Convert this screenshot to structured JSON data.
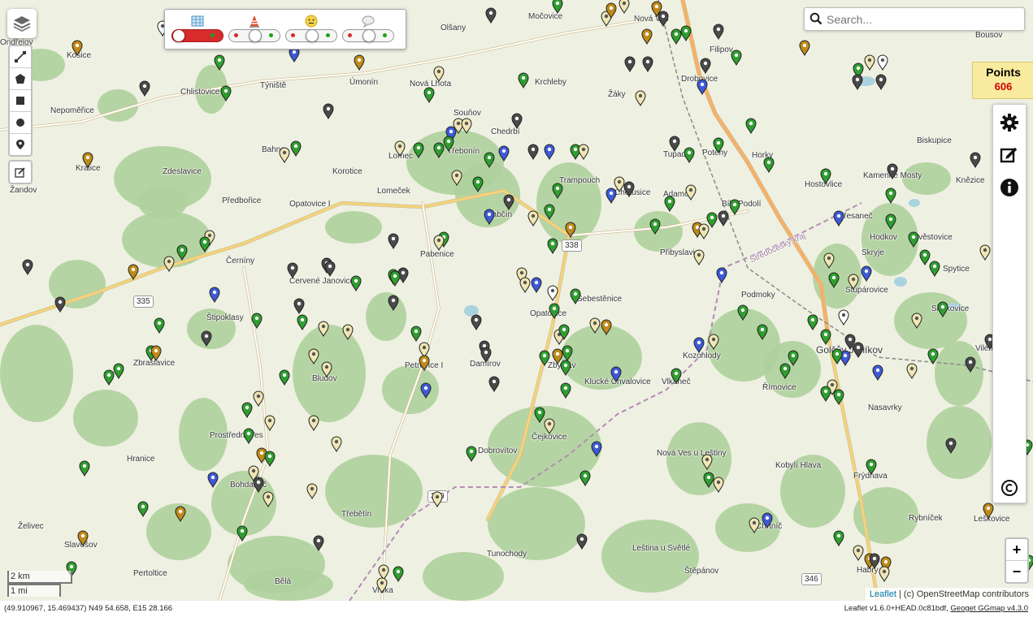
{
  "search": {
    "placeholder": "Search..."
  },
  "points": {
    "label": "Points",
    "count": "606"
  },
  "zoom": {
    "in_label": "+",
    "out_label": "−"
  },
  "scale": {
    "metric": "2 km",
    "imperial": "1 mi"
  },
  "attribution": {
    "leaflet": "Leaflet",
    "text": " | (c) OpenStreetMap contributors"
  },
  "footer": {
    "coords": "(49.910967, 15.469437) N49 54.658, E15 28.166",
    "version_prefix": "Leaflet v1.6.0+HEAD.0c81bdf, ",
    "version_link": "Geoget GGmap v4.3.0"
  },
  "colors": {
    "slider_active": "#d62c2c",
    "points_count": "#d00000",
    "points_bg": "#f8eb9e",
    "forest": "#aed09c"
  },
  "places": [
    "Ondřejov",
    "Kosice",
    "Chlistovice",
    "Týniště",
    "Úmonín",
    "Nová Lhota",
    "Olšany",
    "Močovice",
    "Nová Ves",
    "Filipov",
    "Krchleby",
    "Žáky",
    "Drobovice",
    "Bousov",
    "Nepoměřice",
    "Souňov",
    "Chedrbí",
    "Bahno",
    "Lomec",
    "Třebonín",
    "Tupadly",
    "Potěhy",
    "Horky",
    "Biskupice",
    "Kralice",
    "Zdeslavice",
    "Korotice",
    "Žandov",
    "Předbořice",
    "Lomeček",
    "Trampouch",
    "Chotusice",
    "Adamov",
    "Bílé Podolí",
    "Hostovlice",
    "Kamenné Mosty",
    "Opatovice I",
    "Vrabčín",
    "Pabenice",
    "Přibyslavice",
    "Třesaneč",
    "Zvěstovice",
    "Knězice",
    "Černíny",
    "Červené Janovice",
    "Podmoky",
    "Hodkov",
    "Skryje",
    "Spytice",
    "Štipoklasy",
    "Šebestěnice",
    "Opatovice",
    "Stupárovice",
    "Siřákovice",
    "Zbraslavice",
    "Bludov",
    "Petrovice I",
    "Damírov",
    "Zbyslav",
    "Klucké Chvalovice",
    "Vlkaneč",
    "Kozohlody",
    "Golčův Jeníkov",
    "Vilémov",
    "Římovice",
    "Nasavrky",
    "Prostřední Ves",
    "Hranice",
    "Čejkovice",
    "Dobrovítov",
    "Nová Ves u Leštiny",
    "Kobylí Hlava",
    "Frýdnava",
    "Bohdaneč",
    "Třebětín",
    "Chrtníč",
    "Rybníček",
    "Leškovice",
    "Želivec",
    "Slavošov",
    "Pertoltice",
    "Tunochody",
    "Leština u Světlé",
    "Štěpánov",
    "Bělá",
    "Vrbka",
    "Habry",
    "Středočeský kraj"
  ],
  "roads": [
    "335",
    "338",
    "339",
    "346"
  ]
}
